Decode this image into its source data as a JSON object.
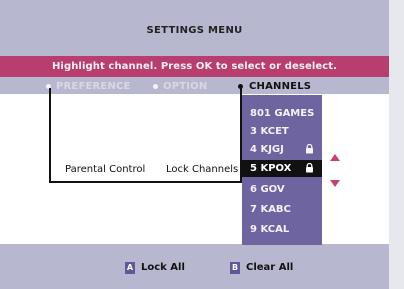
{
  "screen": {
    "title": "SETTINGS MENU",
    "instruction": "Highlight channel. Press OK to select or deselect."
  },
  "tabs": [
    {
      "label": "PREFERENCE",
      "state": "inactive"
    },
    {
      "label": "OPTION",
      "state": "inactive"
    },
    {
      "label": "CHANNELS",
      "state": "active"
    }
  ],
  "menu_path": {
    "parent": "Parental Control",
    "child": "Lock Channels"
  },
  "channels": [
    {
      "label": "801 GAMES",
      "locked": false,
      "selected": false
    },
    {
      "label": "3 KCET",
      "locked": false,
      "selected": false
    },
    {
      "label": "4 KJGJ",
      "locked": true,
      "selected": false
    },
    {
      "label": "5 KPOX",
      "locked": true,
      "selected": true
    },
    {
      "label": "6 GOV",
      "locked": false,
      "selected": false
    },
    {
      "label": "7 KABC",
      "locked": false,
      "selected": false
    },
    {
      "label": "9 KCAL",
      "locked": false,
      "selected": false
    }
  ],
  "footer": {
    "lock_all_key": "A",
    "lock_all_label": "Lock All",
    "clear_all_key": "B",
    "clear_all_label": "Clear All"
  },
  "colors": {
    "background_outer": "#e7e7ee",
    "background_panel": "#b7b7cf",
    "instruction_bar": "#b73e6f",
    "list_panel": "#6e65a0",
    "selected_row": "#111111",
    "arrow_accent": "#c63f77"
  },
  "icons": {
    "lock": "padlock-icon",
    "scroll_up": "triangle-up-icon",
    "scroll_down": "triangle-down-icon"
  }
}
